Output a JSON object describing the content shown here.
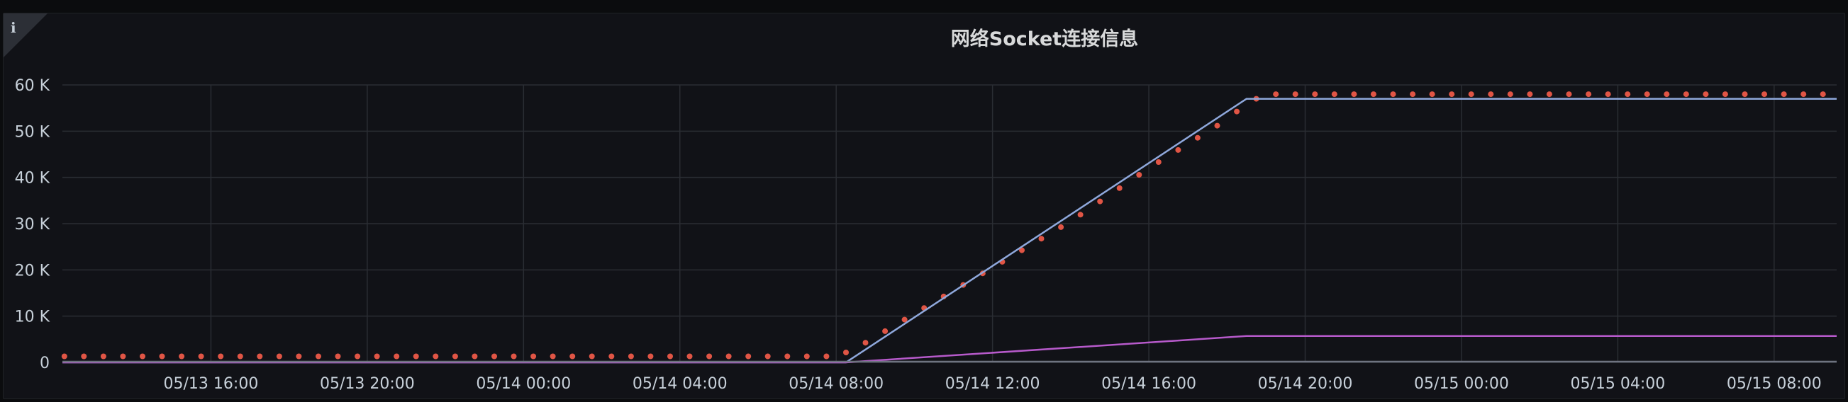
{
  "panel": {
    "title": "网络Socket连接信息",
    "info_icon": "i"
  },
  "chart_data": {
    "type": "line",
    "title": "网络Socket连接信息",
    "xlabel": "",
    "ylabel": "",
    "x_ticks": [
      "05/13 16:00",
      "05/13 20:00",
      "05/14 00:00",
      "05/14 04:00",
      "05/14 08:00",
      "05/14 12:00",
      "05/14 16:00",
      "05/14 20:00",
      "05/15 00:00",
      "05/15 04:00",
      "05/15 08:00"
    ],
    "y_ticks": [
      "0",
      "10 K",
      "20 K",
      "30 K",
      "40 K",
      "50 K",
      "60 K"
    ],
    "xlim": [
      "05/13 12:12",
      "05/15 09:36"
    ],
    "ylim": [
      0,
      60000
    ],
    "grid": true,
    "legend": "none",
    "series": [
      {
        "style": "points",
        "color": "#e05545",
        "points": [
          [
            "05/13 12:15",
            1300
          ],
          [
            "05/14 08:00",
            1300
          ],
          [
            "05/14 08:30",
            3000
          ],
          [
            "05/14 10:00",
            10500
          ],
          [
            "05/14 12:00",
            20500
          ],
          [
            "05/14 14:00",
            30500
          ],
          [
            "05/14 16:00",
            42000
          ],
          [
            "05/14 18:00",
            52500
          ],
          [
            "05/14 18:30",
            56000
          ],
          [
            "05/14 19:00",
            58000
          ],
          [
            "05/15 09:30",
            58000
          ]
        ],
        "step_minutes": 30
      },
      {
        "style": "line",
        "color": "#8fa8dc",
        "points": [
          [
            "05/13 12:12",
            0
          ],
          [
            "05/14 08:15",
            0
          ],
          [
            "05/14 18:30",
            57000
          ],
          [
            "05/15 09:36",
            57000
          ]
        ]
      },
      {
        "style": "line",
        "color": "#b75acb",
        "points": [
          [
            "05/13 12:12",
            0
          ],
          [
            "05/14 08:15",
            0
          ],
          [
            "05/14 18:30",
            5700
          ],
          [
            "05/15 09:36",
            5700
          ]
        ]
      },
      {
        "style": "line",
        "color": "#6e7380",
        "points": [
          [
            "05/13 12:12",
            150
          ],
          [
            "05/15 09:36",
            150
          ]
        ]
      }
    ]
  }
}
